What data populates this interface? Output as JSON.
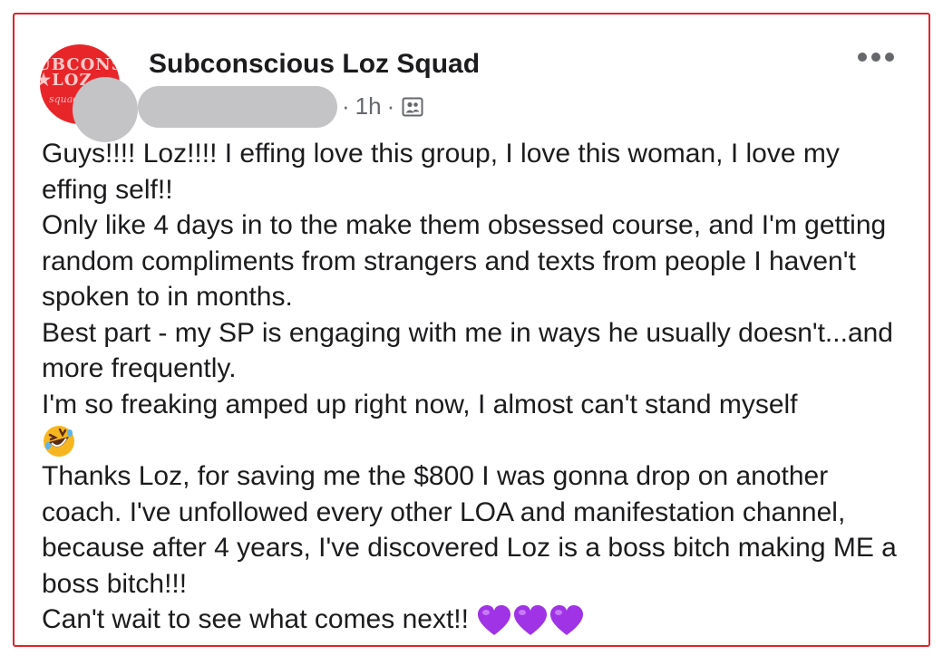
{
  "post": {
    "group_name": "Subconscious Loz Squad",
    "avatar_text": "UBCONSC\n★LOZ",
    "avatar_subtext": "squad",
    "time": "1h",
    "separator": "·",
    "audience_icon": "group-audience-icon",
    "more_icon": "more-options-icon",
    "paragraphs": [
      "Guys!!!! Loz!!!! I effing love this group, I love this woman, I love my effing self!!",
      "Only like 4 days in to the make them obsessed course, and I'm getting random compliments from strangers and texts from people I haven't spoken to in months.",
      "Best part - my SP is engaging with me in ways he usually doesn't...and more frequently.",
      "I'm so freaking amped up right now, I almost can't stand myself",
      "Thanks Loz, for saving me the $800 I was gonna drop on another coach. I've unfollowed every other LOA and manifestation channel, because after 4 years, I've discovered Loz is a boss bitch making ME a boss bitch!!!",
      "Can't wait to see what comes next!!"
    ],
    "emoji_laugh": "rolling-on-floor-laughing-emoji",
    "emoji_hearts": [
      "purple-heart-emoji",
      "purple-heart-emoji",
      "purple-heart-emoji"
    ]
  },
  "colors": {
    "border": "#d9252e",
    "avatar_bg": "#e8262a",
    "meta_gray": "#65676b",
    "heart_purple": "#a033e6",
    "emoji_yellow": "#f7b61f"
  }
}
